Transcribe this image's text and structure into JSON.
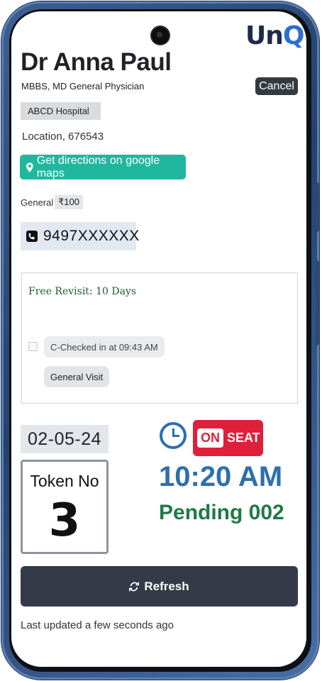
{
  "app": {
    "logo_text_main": "Un",
    "logo_text_accent": "Q"
  },
  "doctor": {
    "name": "Dr Anna Paul",
    "qualifications": "MBBS, MD General Physician",
    "hospital": "ABCD Hospital",
    "location": "Location, 676543",
    "directions_label": "Get directions on google maps",
    "fee_label": "General",
    "fee_amount": "₹100",
    "phone": "9497XXXXXX"
  },
  "header": {
    "cancel_label": "Cancel"
  },
  "visit": {
    "revisit": "Free Revisit: 10 Days",
    "checked_in": "C-Checked in at 09:43 AM",
    "visit_type": "General Visit",
    "checkbox_checked": false
  },
  "token": {
    "date": "02-05-24",
    "label": "Token No",
    "number": "3"
  },
  "status": {
    "on_label": "ON",
    "seat_label": "SEAT",
    "time": "10:20 AM",
    "pending": "Pending 002",
    "badge_color": "#e01f3a",
    "time_color": "#2d6fb0",
    "pending_color": "#1f7a45"
  },
  "footer": {
    "refresh_label": "Refresh",
    "updated": "Last updated a few seconds ago"
  },
  "icons": [
    "map-pin-icon",
    "phone-icon",
    "clock-icon",
    "refresh-icon"
  ]
}
